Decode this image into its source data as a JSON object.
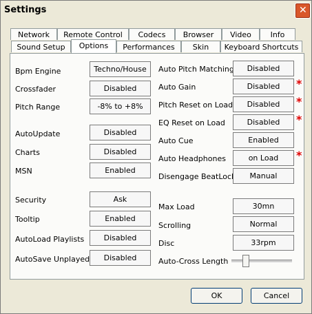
{
  "window": {
    "title": "Settings"
  },
  "tabs": {
    "row1": [
      "Network",
      "Remote Control",
      "Codecs",
      "Browser",
      "Video",
      "Info"
    ],
    "row2": [
      "Sound Setup",
      "Options",
      "Performances",
      "Skin",
      "Keyboard Shortcuts"
    ],
    "active": "Options"
  },
  "left": {
    "bpm_engine": {
      "label": "Bpm Engine",
      "value": "Techno/House"
    },
    "crossfader": {
      "label": "Crossfader",
      "value": "Disabled"
    },
    "pitch_range": {
      "label": "Pitch Range",
      "value": "-8% to +8%"
    },
    "autoupdate": {
      "label": "AutoUpdate",
      "value": "Disabled"
    },
    "charts": {
      "label": "Charts",
      "value": "Disabled"
    },
    "msn": {
      "label": "MSN",
      "value": "Enabled"
    },
    "security": {
      "label": "Security",
      "value": "Ask"
    },
    "tooltip": {
      "label": "Tooltip",
      "value": "Enabled"
    },
    "autoload_playlists": {
      "label": "AutoLoad Playlists",
      "value": "Disabled"
    },
    "autosave_unplayed": {
      "label": "AutoSave Unplayed",
      "value": "Disabled"
    }
  },
  "right": {
    "auto_pitch_matching": {
      "label": "Auto Pitch Matching",
      "value": "Disabled"
    },
    "auto_gain": {
      "label": "Auto Gain",
      "value": "Disabled",
      "required": "*"
    },
    "pitch_reset_on_load": {
      "label": "Pitch Reset on Load",
      "value": "Disabled",
      "required": "*"
    },
    "eq_reset_on_load": {
      "label": "EQ Reset on Load",
      "value": "Disabled",
      "required": "*"
    },
    "auto_cue": {
      "label": "Auto Cue",
      "value": "Enabled"
    },
    "auto_headphones": {
      "label": "Auto Headphones",
      "value": "on Load",
      "required": "*"
    },
    "disengage_beatlock": {
      "label": "Disengage BeatLock",
      "value": "Manual"
    },
    "max_load": {
      "label": "Max Load",
      "value": "30mn"
    },
    "scrolling": {
      "label": "Scrolling",
      "value": "Normal"
    },
    "disc": {
      "label": "Disc",
      "value": "33rpm"
    },
    "auto_cross_length": {
      "label": "Auto-Cross Length",
      "slider_fraction": 0.2
    }
  },
  "buttons": {
    "ok": "OK",
    "cancel": "Cancel"
  },
  "colors": {
    "required_mark": "#e00000",
    "close_button": "#d9572a"
  }
}
